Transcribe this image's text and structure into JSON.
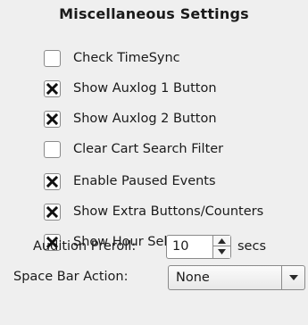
{
  "title": "Miscellaneous Settings",
  "checkboxes": [
    {
      "label": "Check TimeSync",
      "checked": false
    },
    {
      "label": "Show Auxlog 1 Button",
      "checked": true
    },
    {
      "label": "Show Auxlog 2 Button",
      "checked": true
    },
    {
      "label": "Clear Cart Search Filter",
      "checked": false
    },
    {
      "label": "Enable Paused Events",
      "checked": true
    },
    {
      "label": "Show Extra Buttons/Counters",
      "checked": true
    },
    {
      "label": "Show Hour Selector",
      "checked": true
    }
  ],
  "preroll": {
    "label": "Audition Preroll:",
    "value": "10",
    "unit": "secs"
  },
  "space_bar": {
    "label": "Space Bar Action:",
    "value": "None"
  },
  "icons": {
    "check": "x-mark-icon",
    "spin_up": "up-arrow-icon",
    "spin_down": "down-arrow-icon",
    "dropdown": "chevron-down-icon"
  }
}
